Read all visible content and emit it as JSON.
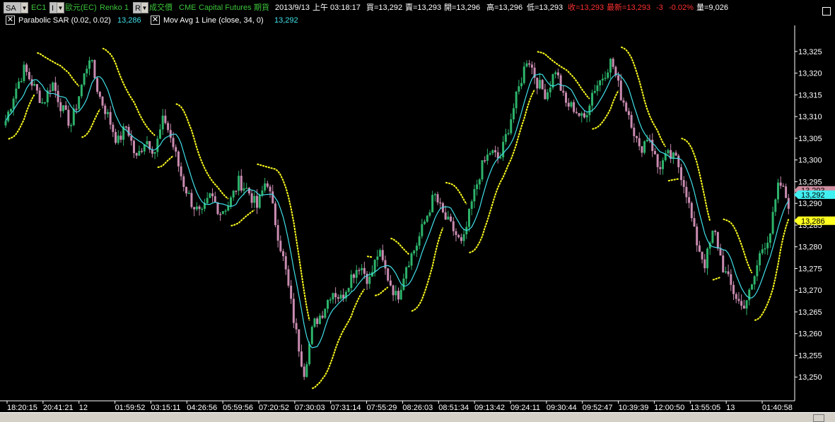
{
  "header": {
    "symbol_box": "SA",
    "symbol": "EC1",
    "name_box": "I",
    "instrument": "歐元(EC)",
    "chart_type": "Renko 1",
    "r_box": "R",
    "price_type": "成交價",
    "exchange": "CME",
    "broker": "Capital Futures",
    "market": "期貨",
    "date": "2013/9/13",
    "time": "上午 03:18:17",
    "bid": "買=13,292",
    "ask": "賣=13,293",
    "open": "開=13,296",
    "high": "高=13,296",
    "low": "低=13,293",
    "close": "收=13,293",
    "last": "最新=13,293",
    "change": "-3",
    "change_pct": "-0.02%",
    "volume": "量=9,026"
  },
  "indicators": [
    {
      "label": "Parabolic SAR (0.02, 0.02)",
      "value": "13,286"
    },
    {
      "label": "Mov Avg 1 Line (close, 34, 0)",
      "value": "13,292"
    }
  ],
  "chart_data": {
    "type": "line",
    "ylim": [
      13245,
      13331
    ],
    "y_ticks": [
      13250,
      13255,
      13260,
      13265,
      13270,
      13275,
      13280,
      13285,
      13290,
      13295,
      13300,
      13305,
      13310,
      13315,
      13320,
      13325
    ],
    "y_tick_labels": [
      "13,250",
      "13,255",
      "13,260",
      "13,265",
      "13,270",
      "13,275",
      "13,280",
      "13,285",
      "13,290",
      "13,295",
      "13,300",
      "13,305",
      "13,310",
      "13,315",
      "13,320",
      "13,325"
    ],
    "x_tick_labels": [
      "18:20:15",
      "20:41:21",
      "12",
      "01:59:52",
      "03:15:11",
      "04:26:56",
      "05:59:56",
      "07:20:52",
      "07:30:03",
      "07:31:14",
      "07:55:29",
      "08:26:03",
      "08:51:34",
      "09:13:42",
      "09:24:11",
      "09:30:44",
      "09:52:47",
      "10:39:39",
      "12:00:50",
      "13:55:05",
      "13",
      "01:40:58"
    ],
    "price_path": [
      13309,
      13316,
      13321,
      13317,
      13313,
      13318,
      13312,
      13308,
      13316,
      13324,
      13315,
      13310,
      13304,
      13308,
      13300,
      13305,
      13302,
      13310,
      13303,
      13295,
      13290,
      13287,
      13292,
      13288,
      13290,
      13295,
      13293,
      13289,
      13296,
      13285,
      13275,
      13262,
      13251,
      13262,
      13265,
      13270,
      13268,
      13273,
      13276,
      13272,
      13279,
      13273,
      13268,
      13276,
      13280,
      13286,
      13292,
      13287,
      13284,
      13280,
      13290,
      13298,
      13302,
      13300,
      13308,
      13316,
      13324,
      13318,
      13315,
      13321,
      13313,
      13312,
      13309,
      13316,
      13319,
      13323,
      13315,
      13310,
      13302,
      13306,
      13298,
      13301,
      13300,
      13293,
      13282,
      13276,
      13284,
      13275,
      13270,
      13266,
      13270,
      13279,
      13283,
      13295,
      13290
    ],
    "series": [
      {
        "name": "Mov Avg 1 Line (close, 34, 0)",
        "color": "#40e0e8"
      },
      {
        "name": "Parabolic SAR (0.02, 0.02)",
        "color": "#ffff20"
      }
    ],
    "last_price_markers": [
      {
        "value": 13293,
        "label": "13,293",
        "color": "#d08fa0"
      },
      {
        "value": 13292,
        "label": "13,292",
        "color": "#40f0f0"
      },
      {
        "value": 13286,
        "label": "13,286",
        "color": "#ffff20"
      }
    ],
    "colors": {
      "up": "#2db36b",
      "down": "#c98bb0",
      "grid": "none",
      "background": "#000000"
    }
  }
}
